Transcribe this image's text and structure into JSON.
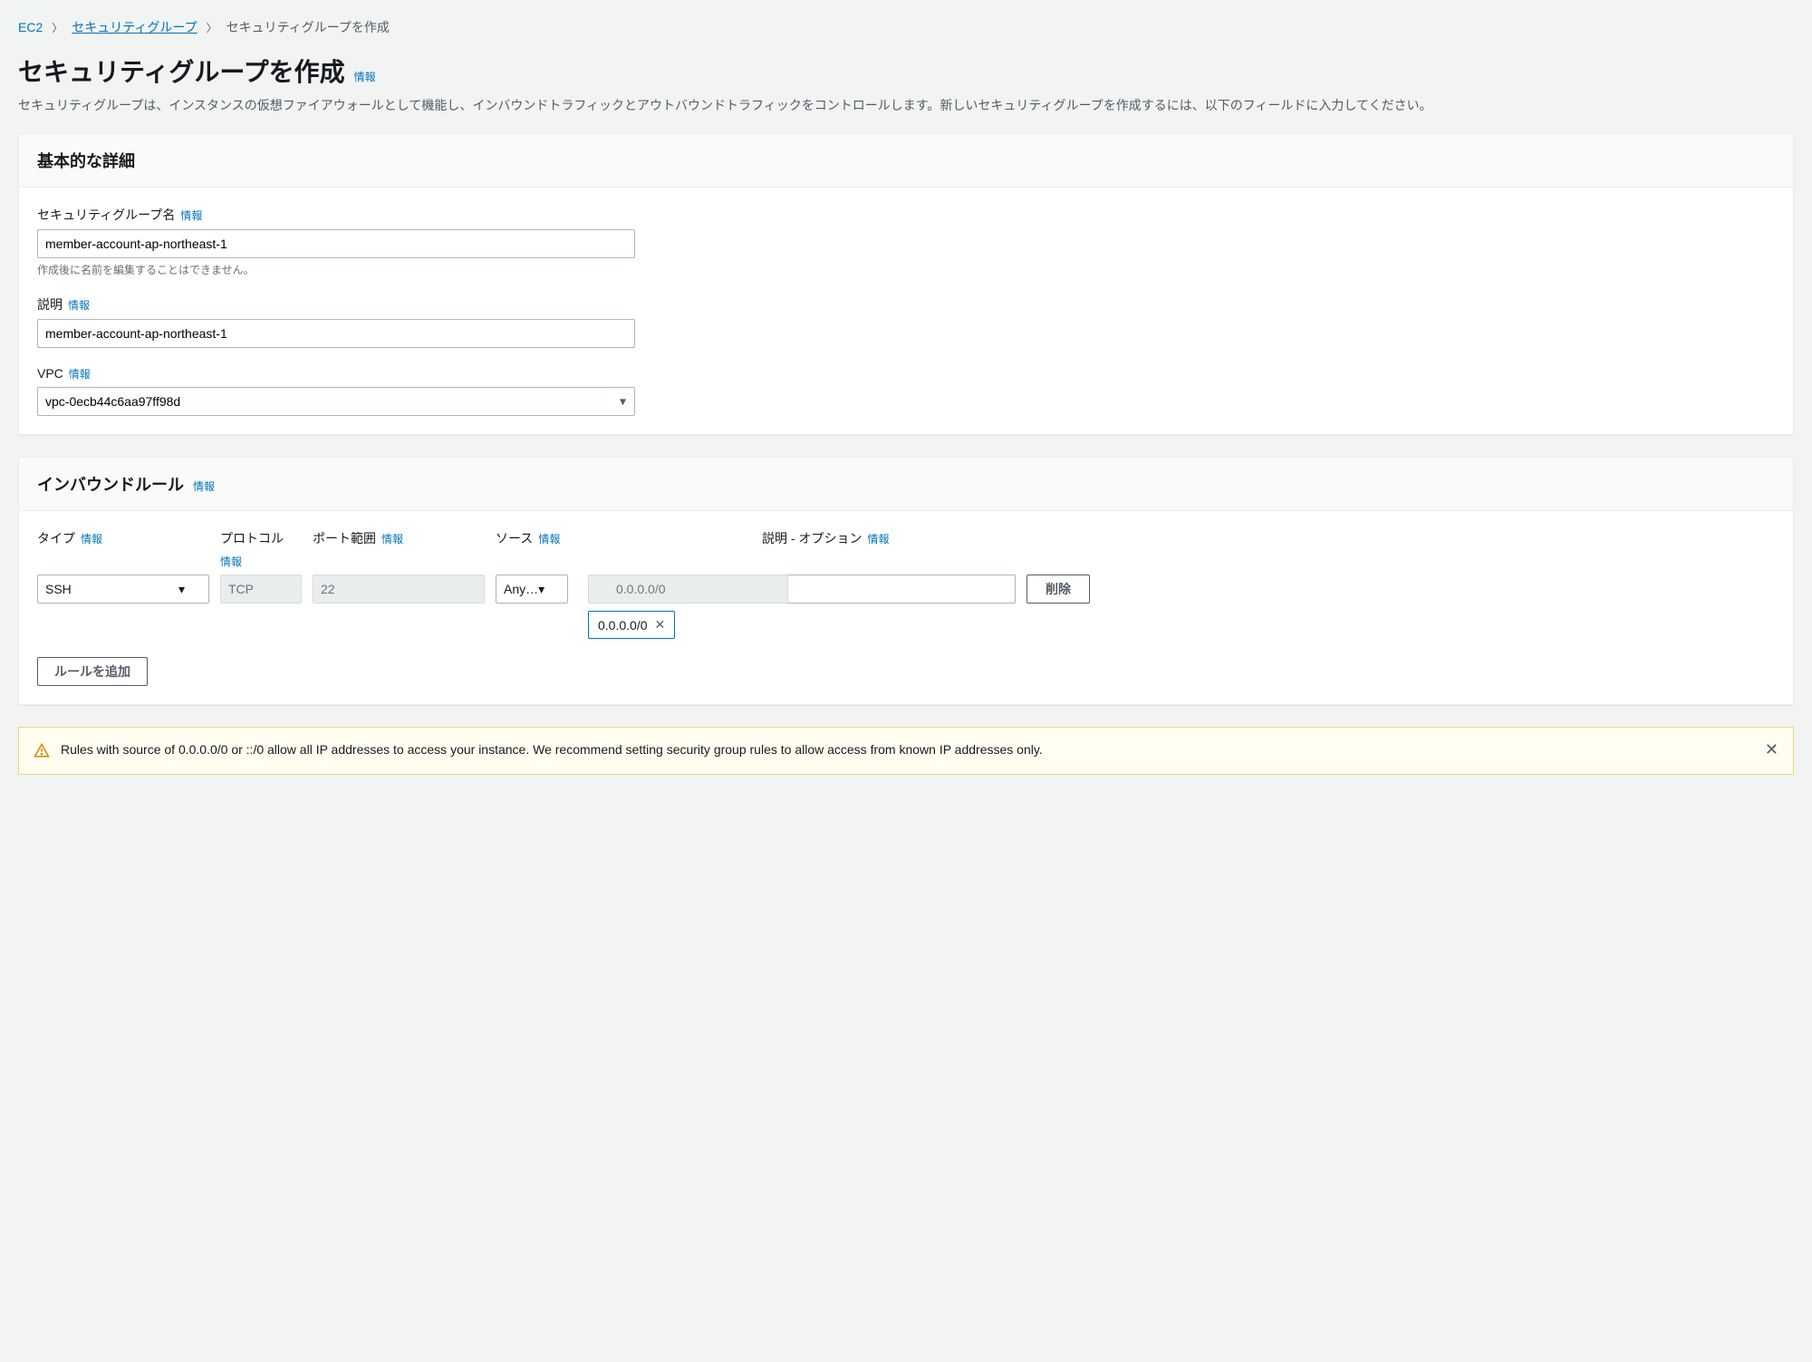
{
  "breadcrumb": {
    "ec2": "EC2",
    "sg": "セキュリティグループ",
    "current": "セキュリティグループを作成"
  },
  "page": {
    "title": "セキュリティグループを作成",
    "info": "情報",
    "desc": "セキュリティグループは、インスタンスの仮想ファイアウォールとして機能し、インバウンドトラフィックとアウトバウンドトラフィックをコントロールします。新しいセキュリティグループを作成するには、以下のフィールドに入力してください。"
  },
  "basic": {
    "header": "基本的な詳細",
    "name_label": "セキュリティグループ名",
    "name_value": "member-account-ap-northeast-1",
    "name_help": "作成後に名前を編集することはできません。",
    "desc_label": "説明",
    "desc_value": "member-account-ap-northeast-1",
    "vpc_label": "VPC",
    "vpc_value": "vpc-0ecb44c6aa97ff98d"
  },
  "inbound": {
    "header": "インバウンドルール",
    "cols": {
      "type": "タイプ",
      "protocol": "プロトコル",
      "port": "ポート範囲",
      "source": "ソース",
      "desc": "説明 - オプション"
    },
    "row": {
      "type": "SSH",
      "protocol": "TCP",
      "port": "22",
      "source_select": "Any…",
      "source_search": "0.0.0.0/0",
      "source_token": "0.0.0.0/0",
      "desc_value": "",
      "delete": "削除"
    },
    "add_rule": "ルールを追加"
  },
  "alert": {
    "msg": "Rules with source of 0.0.0.0/0 or ::/0 allow all IP addresses to access your instance. We recommend setting security group rules to allow access from known IP addresses only."
  },
  "common": {
    "info": "情報"
  }
}
